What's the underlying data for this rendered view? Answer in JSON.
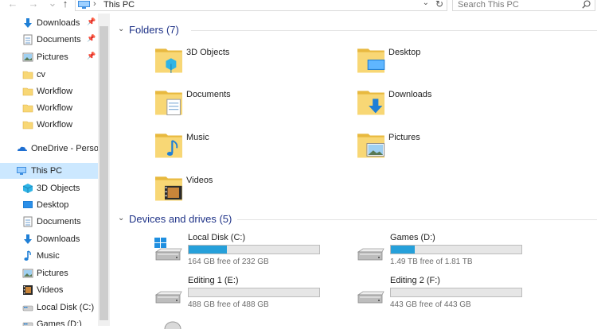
{
  "address": {
    "back_icon": "back-arrow-icon",
    "forward_icon": "forward-arrow-icon",
    "up_icon": "up-arrow-icon",
    "separator": "›",
    "path": "This PC",
    "dropdown_glyph": "⌄",
    "refresh_glyph": "↻"
  },
  "search": {
    "placeholder": "Search This PC"
  },
  "sidebar": {
    "pin_glyph": "📌",
    "items": [
      {
        "label": "Downloads",
        "icon": "downloads-icon",
        "pinned": true
      },
      {
        "label": "Documents",
        "icon": "documents-icon",
        "pinned": true
      },
      {
        "label": "Pictures",
        "icon": "pictures-icon",
        "pinned": true
      },
      {
        "label": "cv",
        "icon": "folder-icon",
        "pinned": false
      },
      {
        "label": "Workflow",
        "icon": "folder-icon",
        "pinned": false
      },
      {
        "label": "Workflow",
        "icon": "folder-icon",
        "pinned": false
      },
      {
        "label": "Workflow",
        "icon": "folder-icon",
        "pinned": false
      },
      {
        "label": "OneDrive - Persor",
        "icon": "onedrive-icon",
        "pinned": false
      },
      {
        "label": "This PC",
        "icon": "this-pc-icon",
        "selected": true
      },
      {
        "label": "3D Objects",
        "icon": "3d-objects-icon"
      },
      {
        "label": "Desktop",
        "icon": "desktop-icon"
      },
      {
        "label": "Documents",
        "icon": "documents-icon"
      },
      {
        "label": "Downloads",
        "icon": "downloads-icon"
      },
      {
        "label": "Music",
        "icon": "music-icon"
      },
      {
        "label": "Pictures",
        "icon": "pictures-icon"
      },
      {
        "label": "Videos",
        "icon": "videos-icon"
      },
      {
        "label": "Local Disk (C:)",
        "icon": "drive-icon"
      },
      {
        "label": "Games (D:)",
        "icon": "drive-icon"
      }
    ]
  },
  "folders": {
    "title": "Folders (7)",
    "chevron": "⌄",
    "items": [
      {
        "label": "3D Objects",
        "icon": "3d-objects-folder-icon"
      },
      {
        "label": "Desktop",
        "icon": "desktop-folder-icon"
      },
      {
        "label": "Documents",
        "icon": "documents-folder-icon"
      },
      {
        "label": "Downloads",
        "icon": "downloads-folder-icon"
      },
      {
        "label": "Music",
        "icon": "music-folder-icon"
      },
      {
        "label": "Pictures",
        "icon": "pictures-folder-icon"
      },
      {
        "label": "Videos",
        "icon": "videos-folder-icon"
      }
    ]
  },
  "drives": {
    "title": "Devices and drives (5)",
    "chevron": "⌄",
    "items": [
      {
        "name": "Local Disk (C:)",
        "free": "164 GB free of 232 GB",
        "used_fraction": 0.29,
        "windows": true
      },
      {
        "name": "Games (D:)",
        "free": "1.49 TB free of 1.81 TB",
        "used_fraction": 0.18,
        "windows": false
      },
      {
        "name": "Editing 1 (E:)",
        "free": "488 GB free of 488 GB",
        "used_fraction": 0.0,
        "windows": false
      },
      {
        "name": "Editing 2 (F:)",
        "free": "443 GB free of 443 GB",
        "used_fraction": 0.0,
        "windows": false
      }
    ]
  },
  "colors": {
    "accent": "#26a0da",
    "selection": "#cce8ff",
    "group_title": "#1e3287",
    "folder_yellow": "#f8d775",
    "folder_dark": "#e8b93f"
  }
}
